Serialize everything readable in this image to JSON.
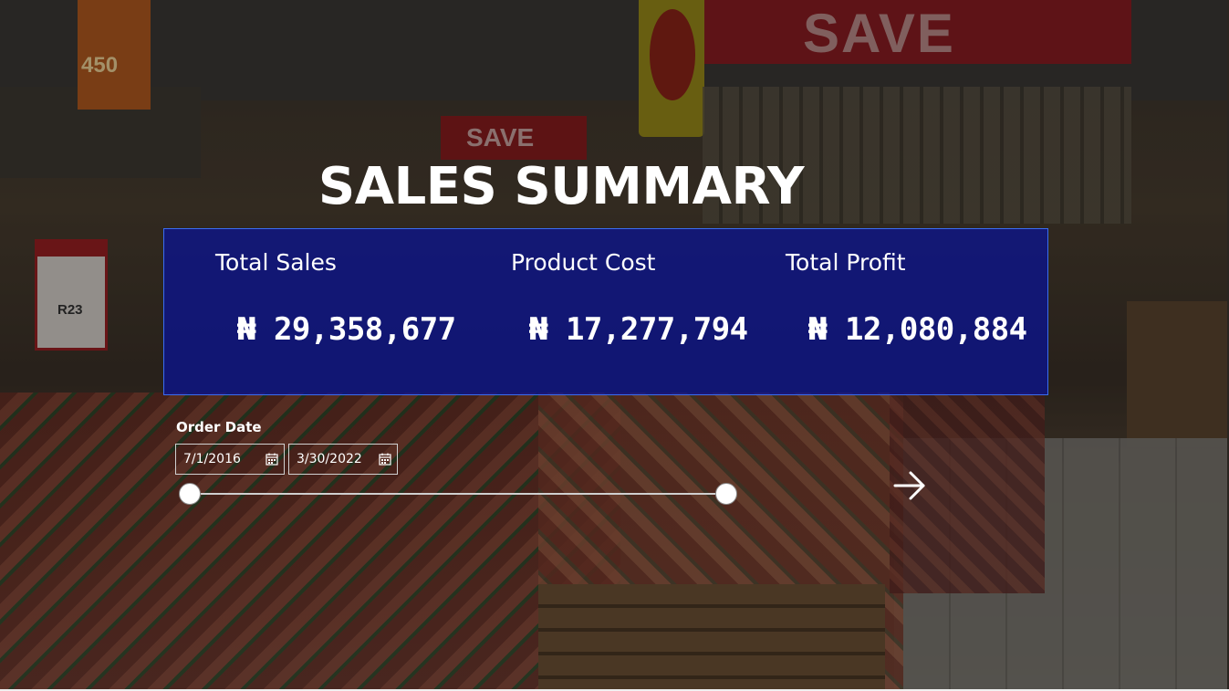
{
  "background": {
    "sign_cheese": "450",
    "banner_save": "SAVE",
    "save_red": "SAVE",
    "sign_left_price": "R23"
  },
  "report": {
    "title": "SALES SUMMARY"
  },
  "kpis": [
    {
      "label": "Total Sales",
      "value": "₦ 29,358,677"
    },
    {
      "label": "Product Cost",
      "value": "₦ 17,277,794"
    },
    {
      "label": "Total Profit",
      "value": "₦ 12,080,884"
    }
  ],
  "slicer": {
    "title": "Order Date",
    "start_date": "7/1/2016",
    "end_date": "3/30/2022",
    "start_icon": "calendar-icon",
    "end_icon": "calendar-icon",
    "range_selected_fraction": [
      0,
      1
    ]
  },
  "navigation": {
    "next_icon": "arrow-right-icon"
  },
  "colors": {
    "panel": "#08129a",
    "panel_border": "#3a6df0",
    "text": "#ffffff"
  }
}
